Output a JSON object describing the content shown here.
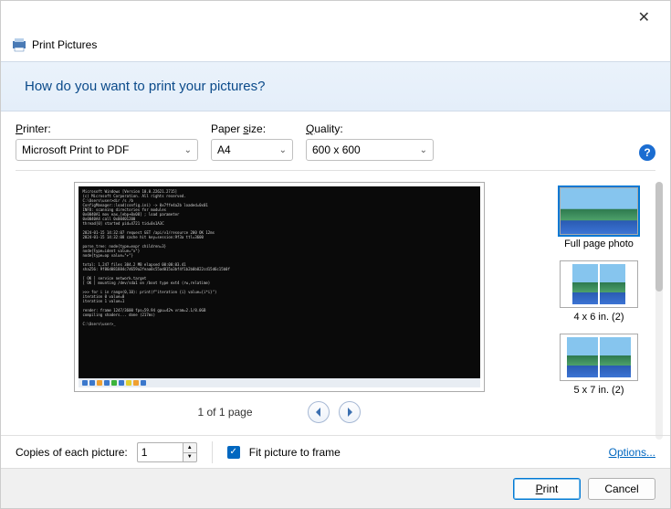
{
  "window": {
    "title": "Print Pictures",
    "heading": "How do you want to print your pictures?"
  },
  "controls": {
    "printer_label": "Printer:",
    "printer_value": "Microsoft Print to PDF",
    "paper_label": "Paper size:",
    "paper_value": "A4",
    "quality_label": "Quality:",
    "quality_value": "600 x 600"
  },
  "pager": {
    "label": "1 of 1 page"
  },
  "layouts": {
    "items": [
      {
        "label": "Full page photo"
      },
      {
        "label": "4 x 6 in. (2)"
      },
      {
        "label": "5 x 7 in. (2)"
      }
    ]
  },
  "footer": {
    "copies_label": "Copies of each picture:",
    "copies_value": "1",
    "fit_label": "Fit picture to frame",
    "fit_checked": true,
    "options_link": "Options..."
  },
  "actions": {
    "print": "Print",
    "cancel": "Cancel"
  }
}
